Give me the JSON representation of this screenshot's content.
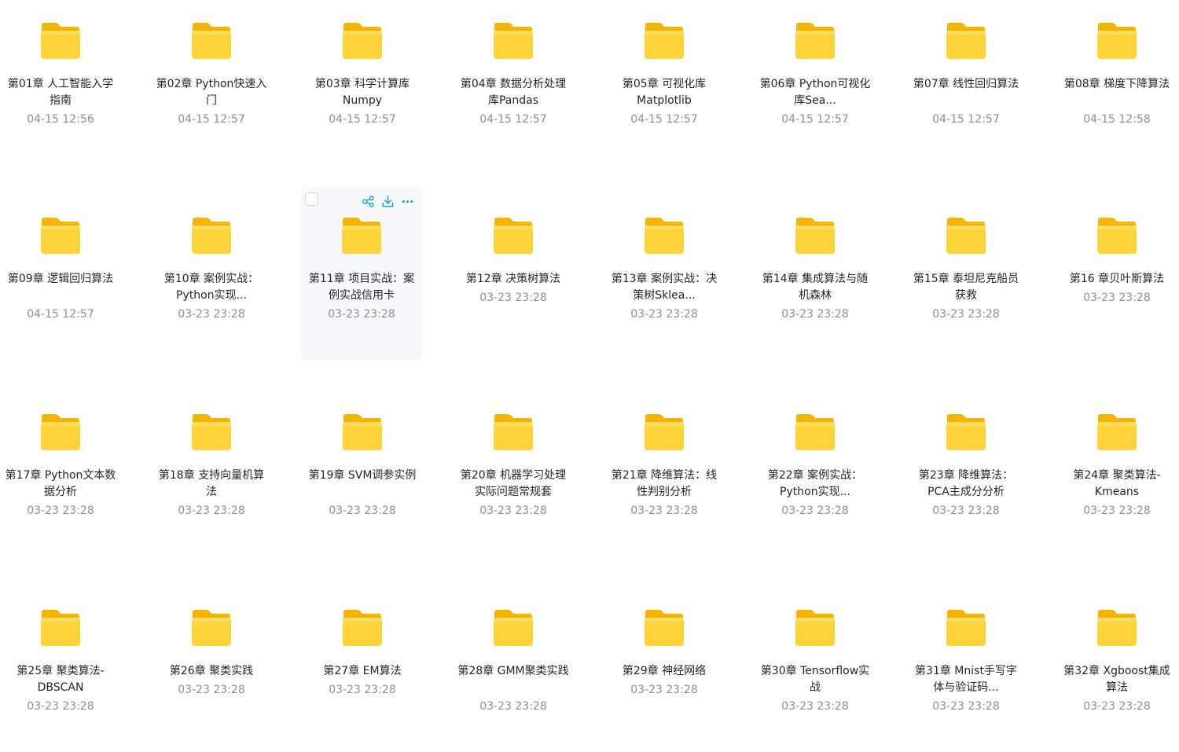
{
  "colors": {
    "folder_back": "#f5b400",
    "folder_front": "#ffd43b",
    "accent": "#1a9ee6",
    "time_text": "#8a9099"
  },
  "hovered_index": 10,
  "hover_actions": [
    {
      "name": "share-icon"
    },
    {
      "name": "download-icon"
    },
    {
      "name": "more-icon"
    }
  ],
  "folders": [
    {
      "name": "第01章 人工智能入学指南",
      "time": "04-15 12:56"
    },
    {
      "name": "第02章 Python快速入门",
      "time": "04-15 12:57"
    },
    {
      "name": "第03章 科学计算库Numpy",
      "time": "04-15 12:57"
    },
    {
      "name": "第04章 数据分析处理库Pandas",
      "time": "04-15 12:57"
    },
    {
      "name": "第05章 可视化库Matplotlib",
      "time": "04-15 12:57"
    },
    {
      "name": "第06章 Python可视化库Sea...",
      "time": "04-15 12:57"
    },
    {
      "name": "第07章 线性回归算法",
      "time": "04-15 12:57"
    },
    {
      "name": "第08章 梯度下降算法",
      "time": "04-15 12:58"
    },
    {
      "name": "第09章 逻辑回归算法",
      "time": "04-15 12:57"
    },
    {
      "name": "第10章 案例实战：Python实现...",
      "time": "03-23 23:28"
    },
    {
      "name": "第11章 项目实战：案例实战信用卡",
      "time": "03-23 23:28"
    },
    {
      "name": "第12章 决策树算法",
      "time": "03-23 23:28"
    },
    {
      "name": "第13章 案例实战：决策树Sklea...",
      "time": "03-23 23:28"
    },
    {
      "name": "第14章 集成算法与随机森林",
      "time": "03-23 23:28"
    },
    {
      "name": "第15章 泰坦尼克船员获救",
      "time": "03-23 23:28"
    },
    {
      "name": "第16 章贝叶斯算法",
      "time": "03-23 23:28"
    },
    {
      "name": "第17章 Python文本数据分析",
      "time": "03-23 23:28"
    },
    {
      "name": "第18章 支持向量机算法",
      "time": "03-23 23:28"
    },
    {
      "name": "第19章 SVM调参实例",
      "time": "03-23 23:28"
    },
    {
      "name": "第20章 机器学习处理实际问题常规套",
      "time": "03-23 23:28"
    },
    {
      "name": "第21章 降维算法：线性判别分析",
      "time": "03-23 23:28"
    },
    {
      "name": "第22章 案例实战：Python实现...",
      "time": "03-23 23:28"
    },
    {
      "name": "第23章 降维算法：PCA主成分分析",
      "time": "03-23 23:28"
    },
    {
      "name": "第24章 聚类算法-Kmeans",
      "time": "03-23 23:28"
    },
    {
      "name": "第25章 聚类算法-DBSCAN",
      "time": "03-23 23:28"
    },
    {
      "name": "第26章 聚类实践",
      "time": "03-23 23:28"
    },
    {
      "name": "第27章 EM算法",
      "time": "03-23 23:28"
    },
    {
      "name": "第28章 GMM聚类实践",
      "time": "03-23 23:28"
    },
    {
      "name": "第29章 神经网络",
      "time": "03-23 23:28"
    },
    {
      "name": "第30章 Tensorflow实战",
      "time": "03-23 23:28"
    },
    {
      "name": "第31章 Mnist手写字体与验证码...",
      "time": "03-23 23:28"
    },
    {
      "name": "第32章 Xgboost集成算法",
      "time": "03-23 23:28"
    }
  ]
}
